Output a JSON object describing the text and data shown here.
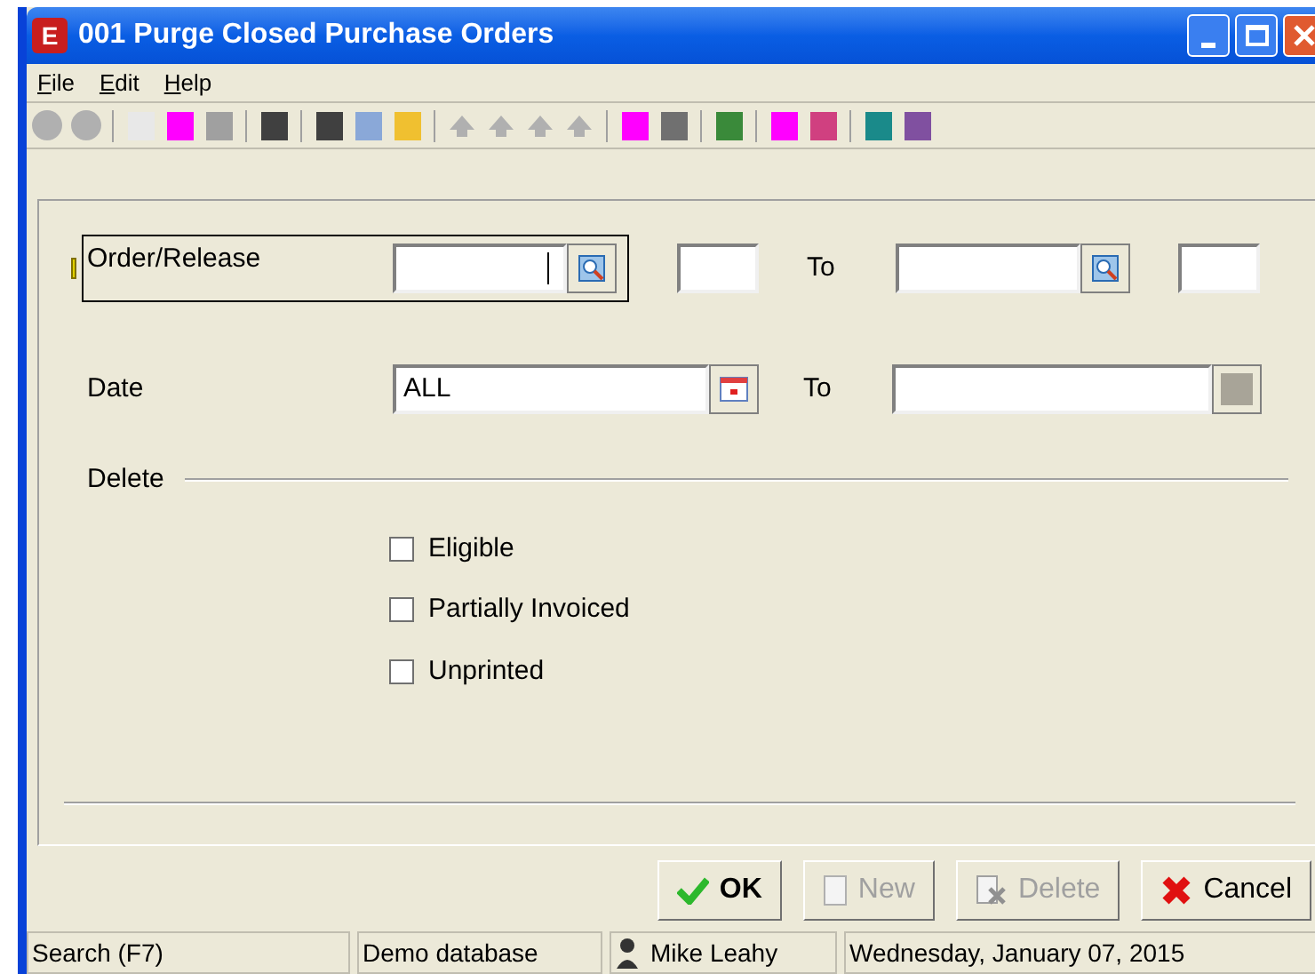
{
  "window": {
    "title": "001 Purge Closed Purchase Orders",
    "logo": "E"
  },
  "menu": [
    {
      "hotkey": "F",
      "rest": "ile"
    },
    {
      "hotkey": "E",
      "rest": "dit"
    },
    {
      "hotkey": "H",
      "rest": "elp"
    }
  ],
  "form": {
    "order_release": {
      "label": "Order/Release",
      "to_label": "To"
    },
    "date": {
      "label": "Date",
      "value": "ALL",
      "to_label": "To"
    },
    "delete": {
      "label": "Delete",
      "options": [
        {
          "label": "Eligible",
          "checked": false
        },
        {
          "label": "Partially Invoiced",
          "checked": false
        },
        {
          "label": "Unprinted",
          "checked": false
        }
      ]
    }
  },
  "buttons": [
    {
      "label": "OK",
      "kind": "ok",
      "disabled": false
    },
    {
      "label": "New",
      "kind": "new",
      "disabled": true
    },
    {
      "label": "Delete",
      "kind": "delete",
      "disabled": true
    },
    {
      "label": "Cancel",
      "kind": "cancel",
      "disabled": false
    }
  ],
  "status_bar": {
    "hint": "Search (F7)",
    "database": "Demo database",
    "user": "Mike Leahy",
    "date": "Wednesday, January 07, 2015"
  }
}
